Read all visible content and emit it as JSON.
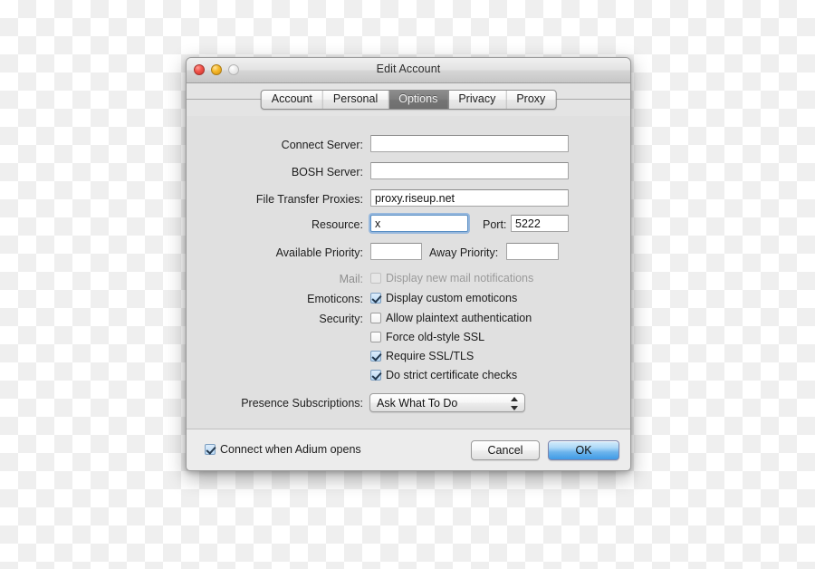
{
  "window": {
    "title": "Edit Account",
    "traffic_lights": [
      "close-red",
      "minimize-yellow",
      "zoom-disabled"
    ]
  },
  "tabs": [
    {
      "label": "Account",
      "selected": false
    },
    {
      "label": "Personal",
      "selected": false
    },
    {
      "label": "Options",
      "selected": true
    },
    {
      "label": "Privacy",
      "selected": false
    },
    {
      "label": "Proxy",
      "selected": false
    }
  ],
  "fields": {
    "connect_server": {
      "label": "Connect Server:",
      "value": "",
      "placeholder": ""
    },
    "bosh_server": {
      "label": "BOSH Server:",
      "value": "",
      "placeholder": ""
    },
    "file_transfer_proxies": {
      "label": "File Transfer Proxies:",
      "value": "proxy.riseup.net",
      "placeholder": ""
    },
    "resource": {
      "label": "Resource:",
      "value": "x",
      "placeholder": "",
      "focused": true
    },
    "port": {
      "label": "Port:",
      "value": "5222",
      "placeholder": ""
    },
    "available_priority": {
      "label": "Available Priority:",
      "value": "",
      "placeholder": ""
    },
    "away_priority": {
      "label": "Away Priority:",
      "value": "",
      "placeholder": ""
    }
  },
  "groups": {
    "mail_label": "Mail:",
    "emoticons_label": "Emoticons:",
    "security_label": "Security:",
    "presence_label": "Presence Subscriptions:"
  },
  "checkboxes": {
    "mail_notifications": {
      "label": "Display new mail notifications",
      "checked": false,
      "disabled": true
    },
    "custom_emoticons": {
      "label": "Display custom emoticons",
      "checked": true,
      "disabled": false
    },
    "allow_plaintext": {
      "label": "Allow plaintext authentication",
      "checked": false,
      "disabled": false
    },
    "force_old_ssl": {
      "label": "Force old-style SSL",
      "checked": false,
      "disabled": false
    },
    "require_ssl_tls": {
      "label": "Require SSL/TLS",
      "checked": true,
      "disabled": false
    },
    "strict_cert_checks": {
      "label": "Do strict certificate checks",
      "checked": true,
      "disabled": false
    },
    "connect_on_open": {
      "label": "Connect when Adium opens",
      "checked": true,
      "disabled": false
    }
  },
  "presence_subscriptions": {
    "selected": "Ask What To Do",
    "options": [
      "Ask What To Do"
    ]
  },
  "buttons": {
    "cancel": "Cancel",
    "ok": "OK"
  },
  "colors": {
    "accent_blue": "#6cb4ec",
    "focus_ring": "#6aa0db",
    "selected_tab_bg": "#7d7d7d",
    "window_bg": "#e0e0e0",
    "bottom_bar_bg": "#ececec"
  }
}
